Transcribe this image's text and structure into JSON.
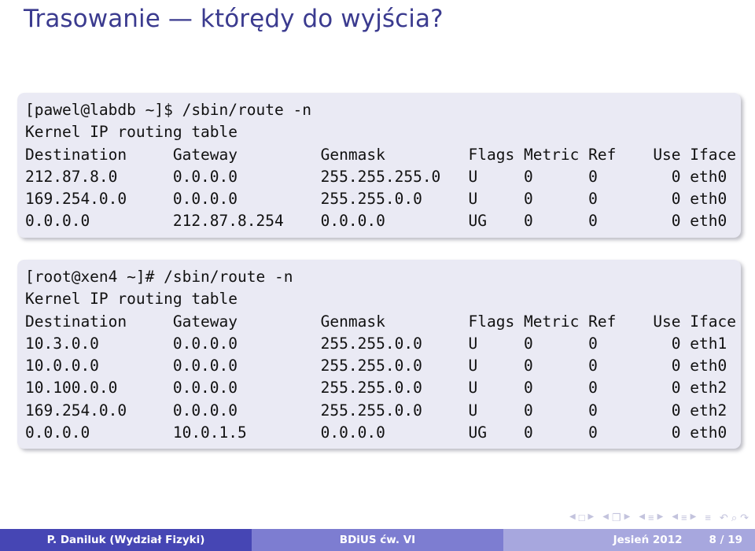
{
  "slide": {
    "title": "Trasowanie — którędy do wyjścia?"
  },
  "code_block_1": {
    "lines": [
      "[pawel@labdb ~]$ /sbin/route -n",
      "Kernel IP routing table",
      "Destination     Gateway         Genmask         Flags Metric Ref    Use Iface",
      "212.87.8.0      0.0.0.0         255.255.255.0   U     0      0        0 eth0",
      "169.254.0.0     0.0.0.0         255.255.0.0     U     0      0        0 eth0",
      "0.0.0.0         212.87.8.254    0.0.0.0         UG    0      0        0 eth0"
    ]
  },
  "code_block_2": {
    "lines": [
      "[root@xen4 ~]# /sbin/route -n",
      "Kernel IP routing table",
      "Destination     Gateway         Genmask         Flags Metric Ref    Use Iface",
      "10.3.0.0        0.0.0.0         255.255.0.0     U     0      0        0 eth1",
      "10.0.0.0        0.0.0.0         255.255.0.0     U     0      0        0 eth0",
      "10.100.0.0      0.0.0.0         255.255.0.0     U     0      0        0 eth2",
      "169.254.0.0     0.0.0.0         255.255.0.0     U     0      0        0 eth2",
      "0.0.0.0         10.0.1.5        0.0.0.0         UG    0      0        0 eth0"
    ]
  },
  "routing_tables": [
    {
      "prompt": "[pawel@labdb ~]$ /sbin/route -n",
      "caption": "Kernel IP routing table",
      "columns": [
        "Destination",
        "Gateway",
        "Genmask",
        "Flags",
        "Metric",
        "Ref",
        "Use",
        "Iface"
      ],
      "rows": [
        [
          "212.87.8.0",
          "0.0.0.0",
          "255.255.255.0",
          "U",
          "0",
          "0",
          "0",
          "eth0"
        ],
        [
          "169.254.0.0",
          "0.0.0.0",
          "255.255.0.0",
          "U",
          "0",
          "0",
          "0",
          "eth0"
        ],
        [
          "0.0.0.0",
          "212.87.8.254",
          "0.0.0.0",
          "UG",
          "0",
          "0",
          "0",
          "eth0"
        ]
      ]
    },
    {
      "prompt": "[root@xen4 ~]# /sbin/route -n",
      "caption": "Kernel IP routing table",
      "columns": [
        "Destination",
        "Gateway",
        "Genmask",
        "Flags",
        "Metric",
        "Ref",
        "Use",
        "Iface"
      ],
      "rows": [
        [
          "10.3.0.0",
          "0.0.0.0",
          "255.255.0.0",
          "U",
          "0",
          "0",
          "0",
          "eth1"
        ],
        [
          "10.0.0.0",
          "0.0.0.0",
          "255.255.0.0",
          "U",
          "0",
          "0",
          "0",
          "eth0"
        ],
        [
          "10.100.0.0",
          "0.0.0.0",
          "255.255.0.0",
          "U",
          "0",
          "0",
          "0",
          "eth2"
        ],
        [
          "169.254.0.0",
          "0.0.0.0",
          "255.255.0.0",
          "U",
          "0",
          "0",
          "0",
          "eth2"
        ],
        [
          "0.0.0.0",
          "10.0.1.5",
          "0.0.0.0",
          "UG",
          "0",
          "0",
          "0",
          "eth0"
        ]
      ]
    }
  ],
  "nav_symbols": {
    "arrow_left": "◀",
    "arrow_right": "▶",
    "slide_glyph": "□",
    "frame_glyph": "❐",
    "subsection_glyph": "≡",
    "section_glyph": "≡",
    "toc_glyph": "≡",
    "back_glyph": "↶",
    "search_glyph": "⌕",
    "forward_glyph": "↷"
  },
  "footer": {
    "author": "P. Daniluk  (Wydział Fizyki)",
    "course": "BDiUS ćw. VI",
    "date": "Jesień 2012",
    "page": "8 / 19"
  },
  "colors": {
    "title": "#3b3b8f",
    "code_bg": "#eaeaf4",
    "footer_left": "#4646b4",
    "footer_middle": "#7d7dd1",
    "footer_right": "#a7a7de",
    "nav_symbols": "#c3c3dd"
  }
}
